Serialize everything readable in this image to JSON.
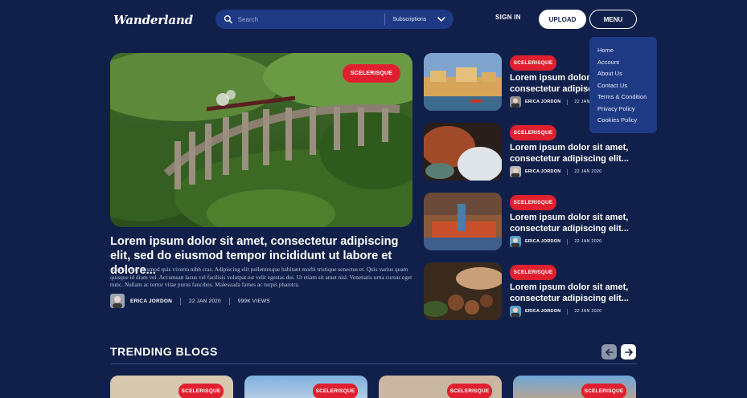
{
  "header": {
    "logo_text": "Wanderland",
    "search": {
      "placeholder": "Search",
      "subscriptions_label": "Subscriptions"
    },
    "signin_label": "SIGN IN",
    "upload_label": "UPLOAD",
    "menu_label": "MENU",
    "menu_items": [
      "Home",
      "Account",
      "About Us",
      "Contact Us",
      "Terms & Condition",
      "Privacy Policy",
      "Cookies Policy"
    ]
  },
  "hero": {
    "tag": "SCELERISQUE",
    "title": "Lorem ipsum dolor sit amet, consectetur adipiscing elit, sed do eiusmod tempor incididunt ut labore et dolore...",
    "description": "Arcu cursus euismod quis viverra nibh cras. Adipiscing elit pellentesque habitant morbi tristique senectus et. Quis varius quam quisque id diam vel. Accumsan lacus vel facilisis volutpat est velit egestas dui. Ut etiam sit amet nisl. Venenatis urna cursus eget nunc. Nullam ac tortor vitae purus faucibus. Malesuada fames ac turpis pharetra.",
    "author": "ERICA JORDON",
    "date": "22 JAN 2020",
    "views": "999K VIEWS"
  },
  "side_posts": [
    {
      "tag": "SCELERISQUE",
      "title": "Lorem ipsum dolor sit amet, consectetur adipiscing elit...",
      "author": "ERICA JORDON",
      "date": "22 JAN 2020"
    },
    {
      "tag": "SCELERISQUE",
      "title": "Lorem ipsum dolor sit amet, consectetur adipiscing elit...",
      "author": "ERICA JORDON",
      "date": "22 JAN 2020"
    },
    {
      "tag": "SCELERISQUE",
      "title": "Lorem ipsum dolor sit amet, consectetur adipiscing elit...",
      "author": "ERICA JORDON",
      "date": "22 JAN 2020"
    },
    {
      "tag": "SCELERISQUE",
      "title": "Lorem ipsum dolor sit amet, consectetur adipiscing elit...",
      "author": "ERICA JORDON",
      "date": "22 JAN 2020"
    }
  ],
  "trending": {
    "title": "TRENDING BLOGS",
    "cards": [
      {
        "tag": "SCELERISQUE"
      },
      {
        "tag": "SCELERISQUE"
      },
      {
        "tag": "SCELERISQUE"
      },
      {
        "tag": "SCELERISQUE"
      }
    ]
  },
  "colors": {
    "background": "#10204a",
    "accent": "#e0202f",
    "surface": "#1e3a84"
  }
}
